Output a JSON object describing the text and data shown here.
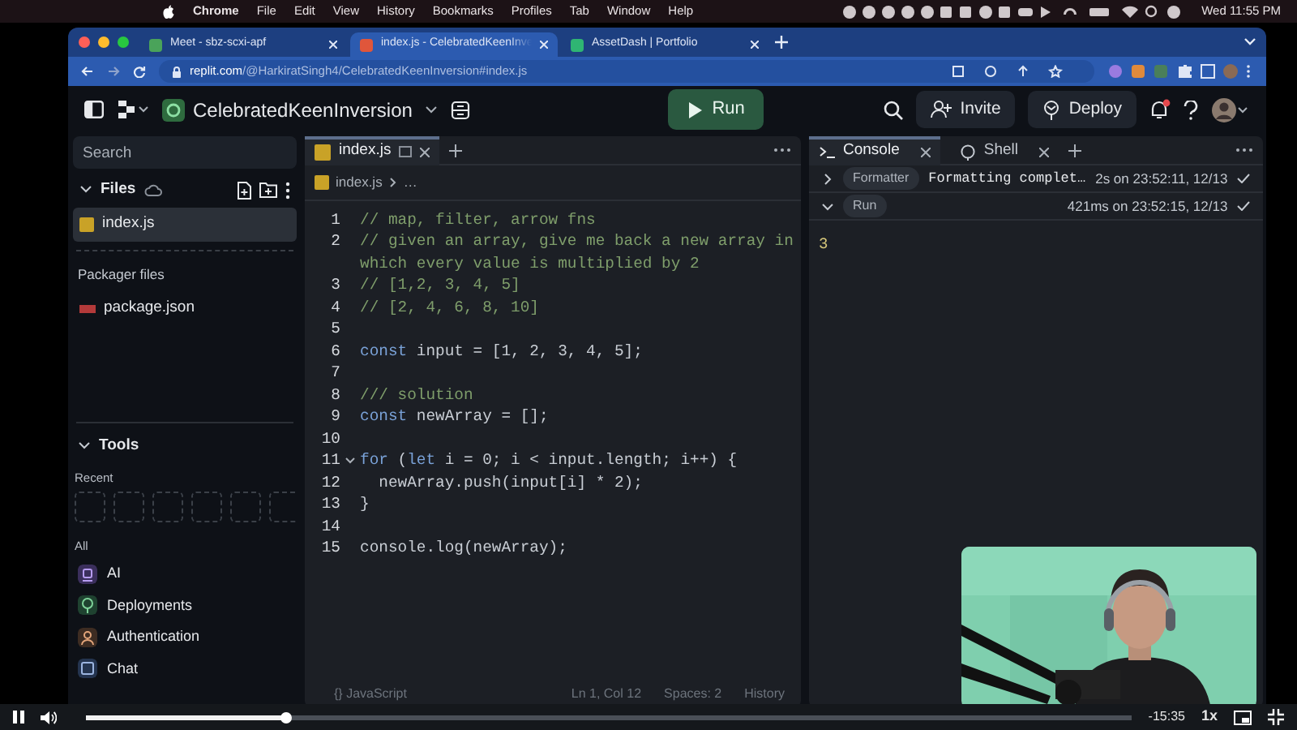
{
  "menu_bar": {
    "app": "Chrome",
    "items": [
      "File",
      "Edit",
      "View",
      "History",
      "Bookmarks",
      "Profiles",
      "Tab",
      "Window",
      "Help"
    ],
    "clock": "Wed 11:55 PM"
  },
  "browser": {
    "tabs": [
      {
        "title": "Meet - sbz-scxi-apf",
        "kind": "meet",
        "selected": false
      },
      {
        "title": "index.js - CelebratedKeenInve",
        "kind": "replit",
        "selected": true
      },
      {
        "title": "AssetDash | Portfolio",
        "kind": "asset",
        "selected": false
      }
    ],
    "url": {
      "host": "replit.com",
      "path": "/@HarkiratSingh4/CelebratedKeenInversion#index.js"
    }
  },
  "header": {
    "repl_name": "CelebratedKeenInversion",
    "run": "Run",
    "invite": "Invite",
    "deploy": "Deploy"
  },
  "sidebar": {
    "search_placeholder": "Search",
    "files_heading": "Files",
    "files": [
      {
        "name": "index.js",
        "selected": true
      }
    ],
    "packager_heading": "Packager files",
    "packager_files": [
      "package.json"
    ],
    "tools_heading": "Tools",
    "recent_label": "Recent",
    "all_label": "All",
    "tools": [
      {
        "name": "AI",
        "kind": "ai"
      },
      {
        "name": "Deployments",
        "kind": "deploy"
      },
      {
        "name": "Authentication",
        "kind": "auth"
      },
      {
        "name": "Chat",
        "kind": "chat"
      }
    ]
  },
  "editor": {
    "tab": "index.js",
    "breadcrumb": [
      "index.js",
      "…"
    ],
    "lines": [
      {
        "number": "1",
        "tokens": [
          {
            "kind": "comment",
            "text": "// map, filter, arrow fns"
          }
        ]
      },
      {
        "number": "2",
        "tokens": [
          {
            "kind": "comment",
            "text": "// given an array, give me back a new array in which every value is multiplied by 2"
          }
        ]
      },
      {
        "number": "3",
        "tokens": [
          {
            "kind": "comment",
            "text": "// [1,2, 3, 4, 5]"
          }
        ]
      },
      {
        "number": "4",
        "tokens": [
          {
            "kind": "comment",
            "text": "// [2, 4, 6, 8, 10]"
          }
        ]
      },
      {
        "number": "5"
      },
      {
        "number": "6",
        "tokens": [
          {
            "kind": "keyword",
            "text": "const"
          },
          {
            "kind": "plain",
            "text": " input = [1, 2, 3, 4, 5];"
          }
        ]
      },
      {
        "number": "7"
      },
      {
        "number": "8",
        "tokens": [
          {
            "kind": "comment",
            "text": "/// solution"
          }
        ]
      },
      {
        "number": "9",
        "tokens": [
          {
            "kind": "keyword",
            "text": "const"
          },
          {
            "kind": "plain",
            "text": " newArray = [];"
          }
        ]
      },
      {
        "number": "10"
      },
      {
        "number": "11",
        "fold": true,
        "tokens": [
          {
            "kind": "keyword",
            "text": "for"
          },
          {
            "kind": "plain",
            "text": " ("
          },
          {
            "kind": "keyword",
            "text": "let"
          },
          {
            "kind": "plain",
            "text": " i = 0; i < input.length; i++) {"
          }
        ]
      },
      {
        "number": "12",
        "tokens": [
          {
            "kind": "plain",
            "text": "  newArray.push(input[i] * 2);"
          }
        ]
      },
      {
        "number": "13",
        "tokens": [
          {
            "kind": "plain",
            "text": "}"
          }
        ]
      },
      {
        "number": "14"
      },
      {
        "number": "15",
        "tokens": [
          {
            "kind": "plain",
            "text": "console.log(newArray);"
          }
        ]
      }
    ],
    "status": {
      "language": "{} JavaScript",
      "position": "Ln 1, Col 12",
      "spaces": "Spaces: 2",
      "history": "History"
    }
  },
  "console": {
    "tabs": [
      {
        "label": "Console",
        "kind": "console",
        "selected": true
      },
      {
        "label": "Shell",
        "kind": "shell",
        "selected": false
      }
    ],
    "entries": [
      {
        "label": "Formatter",
        "message": "Formatting complet…",
        "time": "2s on 23:52:11, 12/13",
        "expanded": false
      },
      {
        "label": "Run",
        "time": "421ms on 23:52:15, 12/13",
        "expanded": true
      }
    ],
    "output": "3"
  },
  "player": {
    "level": 0.19,
    "time": "-15:35",
    "speed": "1x"
  }
}
